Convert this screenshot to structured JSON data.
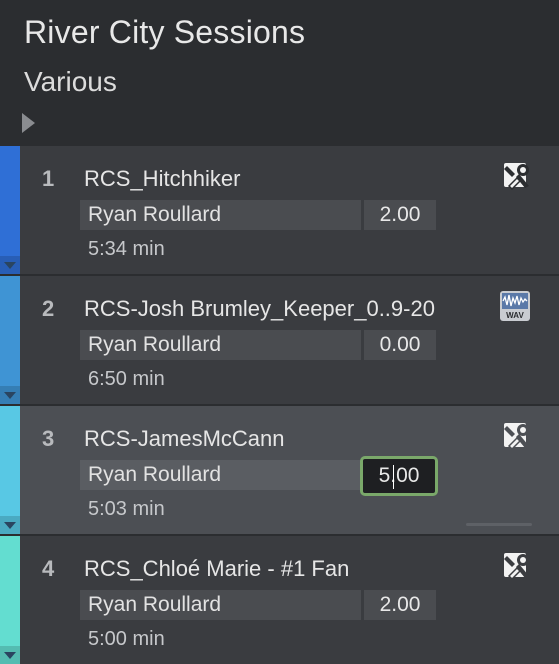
{
  "header": {
    "title": "River City Sessions",
    "subtitle": "Various"
  },
  "tracks": [
    {
      "number": "1",
      "name": "RCS_Hitchhiker",
      "artist": "Ryan Roullard",
      "value": "2.00",
      "duration": "5:34 min",
      "color": "#2f6fd6",
      "icon": "tools-icon"
    },
    {
      "number": "2",
      "name": "RCS-Josh Brumley_Keeper_0..9-20",
      "artist": "Ryan Roullard",
      "value": "0.00",
      "duration": "6:50 min",
      "color": "#3f94d4",
      "icon": "wav-file-icon",
      "icon_text": "WAV"
    },
    {
      "number": "3",
      "name": "RCS-JamesMcCann",
      "artist": "Ryan Roullard",
      "value": "5.00",
      "duration": "5:03 min",
      "color": "#58c8e4",
      "icon": "tools-icon",
      "selected": true,
      "editing": true
    },
    {
      "number": "4",
      "name": "RCS_Chloé Marie - #1 Fan",
      "artist": "Ryan Roullard",
      "value": "2.00",
      "duration": "5:00 min",
      "color": "#63ddd0",
      "icon": "tools-icon"
    }
  ]
}
